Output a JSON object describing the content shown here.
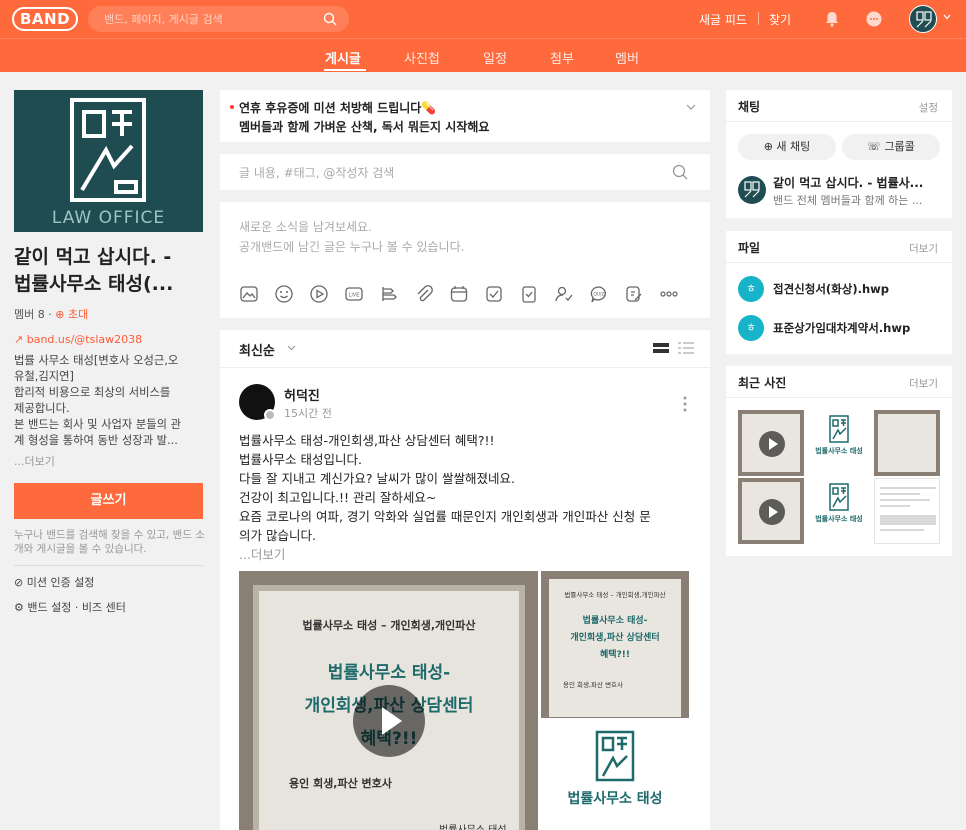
{
  "header": {
    "logo": "BAND",
    "search_placeholder": "밴드, 페이지, 게시글 검색",
    "new_feed": "새글 피드",
    "find": "찾기"
  },
  "tabs": [
    {
      "label": "게시글",
      "active": true
    },
    {
      "label": "사진첩",
      "active": false
    },
    {
      "label": "일정",
      "active": false
    },
    {
      "label": "첨부",
      "active": false
    },
    {
      "label": "멤버",
      "active": false
    }
  ],
  "band": {
    "cover_text": "LAW OFFICE",
    "title_line1": "같이 먹고 삽시다. -",
    "title_line2": "법률사무소 태성(...",
    "members_label": "멤버 8 · ",
    "invite": "초대",
    "url": "band.us/@tslaw2038",
    "description": [
      "법률 사무소 태성[변호사 오성근,오",
      "유철,김지연]",
      "합리적 비용으로 최상의 서비스를",
      "제공합니다.",
      "본 밴드는 회사 및 사업자 분들의 관",
      "계 형성을 통하여 동반 성장과 발..."
    ],
    "more": "...더보기",
    "write_button": "글쓰기",
    "note": "누구나 밴드를 검색해 찾을 수 있고, 밴드 소개와 게시글을 볼 수 있습니다.",
    "mission_setting": "미션 인증 설정",
    "band_setting": "밴드 설정",
    "biz_center": "비즈 센터"
  },
  "notice": {
    "line1": "연휴 후유증에 미션 처방해 드립니다💊",
    "line2": "멤버들과 함께 가벼운 산책, 독서 뭐든지 시작해요"
  },
  "post_search_placeholder": "글 내용, #태그, @작성자 검색",
  "composer": {
    "placeholder1": "새로운 소식을 남겨보세요.",
    "placeholder2": "공개밴드에 남긴 글은 누구나 볼 수 있습니다."
  },
  "feed": {
    "sort": "최신순",
    "post": {
      "author": "허덕진",
      "time": "15시간 전",
      "lines": [
        "법률사무소 태성-개인회생,파산 상담센터 혜택?!!",
        "법률사무소 태성입니다.",
        "다들 잘 지내고 계신가요? 날씨가 많이 쌀쌀해졌네요.",
        "건강이 최고입니다.!! 관리 잘하세요~",
        "요즘 코로나의 여파, 경기 악화와 실업률 때문인지 개인회생과 개인파산 신청 문",
        "의가 많습니다."
      ],
      "more": "...더보기",
      "photo_main": {
        "line1": "법률사무소 태성 – 개인회생,개인파산",
        "line2a": "법률사무소 태성-",
        "line2b": "개인회생,파산 상담센터",
        "line2c": "혜택?!!",
        "line3": "용인 회생,파산 변호사",
        "brand": "법률사무소 태성"
      },
      "photo_side": {
        "line1": "법률사무소 태성 – 개인회생,개인파산",
        "line2a": "법률사무소 태성-",
        "line2b": "개인회생,파산 상담센터",
        "line2c": "혜택?!!",
        "line3": "용인 회생,파산 변호사",
        "brand": "법률사무소 태성"
      }
    }
  },
  "chat": {
    "title": "채팅",
    "settings": "설정",
    "new_chat": "새 채팅",
    "group_call": "그룹콜",
    "room_name": "같이 먹고 삽시다. - 법률사...",
    "room_sub": "밴드 전체 멤버들과 함께 하는 ..."
  },
  "files": {
    "title": "파일",
    "more": "더보기",
    "items": [
      "접견신청서(화상).hwp",
      "표준상가임대차계약서.hwp"
    ]
  },
  "photos": {
    "title": "최근 사진",
    "more": "더보기",
    "brand": "법률사무소 태성"
  },
  "colors": {
    "brand": "#ff6a3d",
    "file_icon": "#16b3c9",
    "logo_green": "#1e4c51"
  }
}
